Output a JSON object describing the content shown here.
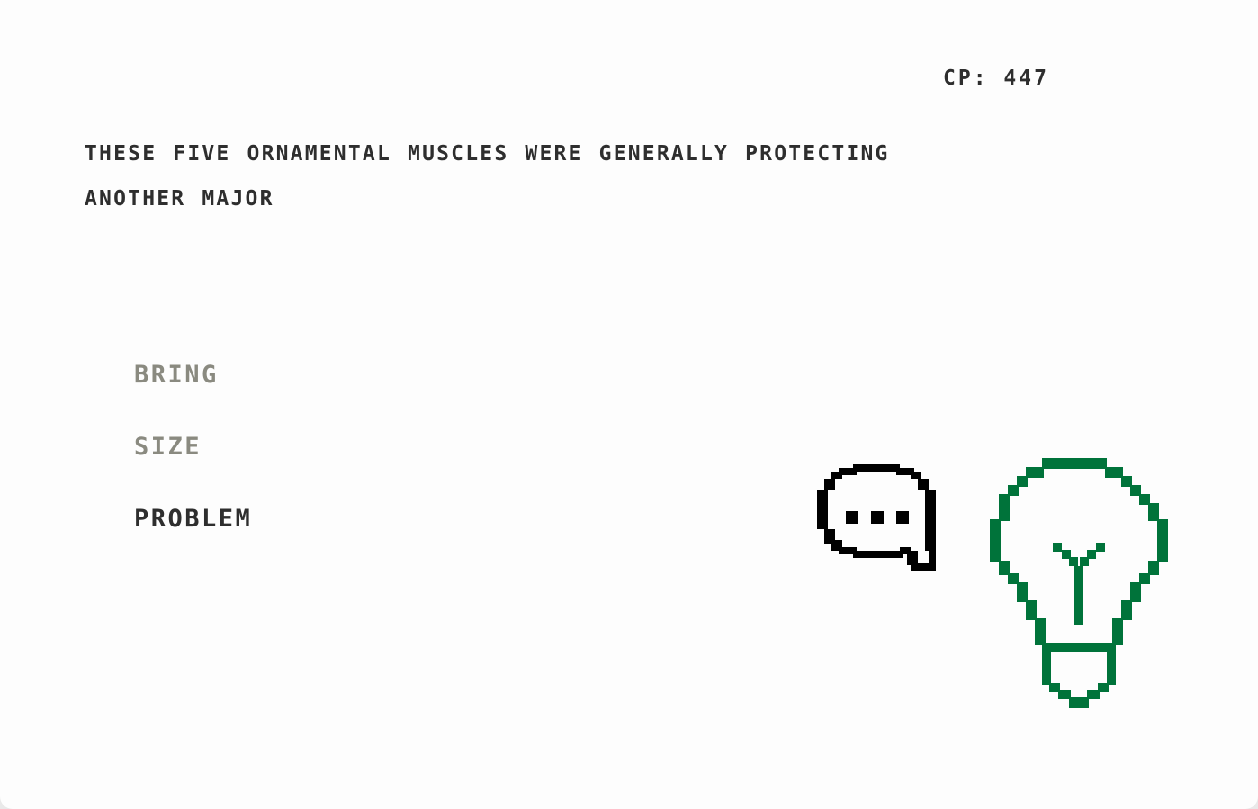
{
  "hud": {
    "cp_text": "CP: 447"
  },
  "prompt": {
    "line1": "THESE FIVE ORNAMENTAL MUSCLES WERE GENERALLY PROTECTING",
    "line2": "ANOTHER MAJOR"
  },
  "choices": [
    {
      "label": "BRING",
      "state": "dim"
    },
    {
      "label": "SIZE",
      "state": "dim"
    },
    {
      "label": "PROBLEM",
      "state": "active"
    }
  ],
  "icons": {
    "speech": "speech-bubble-icon",
    "hint": "lightbulb-icon"
  },
  "colors": {
    "text": "#2e2e2e",
    "dim_text": "#8a8a80",
    "bulb": "#00733a",
    "bubble": "#000000"
  }
}
